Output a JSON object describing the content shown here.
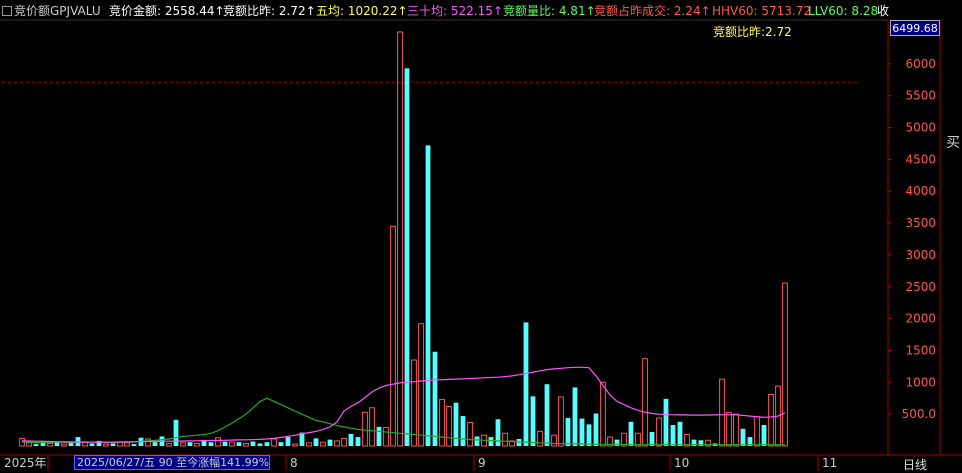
{
  "header": {
    "items": [
      {
        "text": "竞价额GPJVALU",
        "color": "#cccccc",
        "x": 14
      },
      {
        "text": "竞价金额: 2558.44↑",
        "color": "#ffffff",
        "x": 109
      },
      {
        "text": "竞额比昨: 2.72↑",
        "color": "#ffffff",
        "x": 223
      },
      {
        "text": "五均: 1020.22↑",
        "color": "#ffff55",
        "x": 316
      },
      {
        "text": "三十均: 522.15↑",
        "color": "#ff55ff",
        "x": 407
      },
      {
        "text": "竞额量比: 4.81↑",
        "color": "#55ff55",
        "x": 503
      },
      {
        "text": "竞额占昨成交: 2.24↑",
        "color": "#ff5555",
        "x": 594
      },
      {
        "text": "HHV60: 5713.72",
        "color": "#ff5555",
        "x": 712
      },
      {
        "text": "LLV60: 8.28",
        "color": "#55ff55",
        "x": 808
      },
      {
        "text": "收",
        "color": "#ffffff",
        "x": 877
      }
    ],
    "sub_label": "竞额比昨:2.72"
  },
  "axis": {
    "current_value": "6499.68",
    "tick_labels": [
      "6500",
      "6000",
      "5500",
      "5000",
      "4500",
      "4000",
      "3500",
      "3000",
      "2500",
      "2000",
      "1500",
      "1000",
      "500.0"
    ],
    "side_button": "买"
  },
  "bottom": {
    "year": "2025年",
    "range_text": "2025/06/27/五 90 至今涨幅141.99%",
    "months": [
      "8",
      "9",
      "10",
      "11"
    ],
    "period": "日线"
  },
  "colors": {
    "up": "#ff5555",
    "down": "#55ffff",
    "ma5": "#ffff55",
    "ma30": "#ff55ff",
    "grid": "#aa0000"
  },
  "chart_data": {
    "type": "bar",
    "ylim": [
      0,
      6500
    ],
    "hhv_line": 5713.72,
    "bars": [
      [
        120,
        1
      ],
      [
        50,
        1
      ],
      [
        30,
        0
      ],
      [
        80,
        0
      ],
      [
        40,
        1
      ],
      [
        60,
        0
      ],
      [
        30,
        1
      ],
      [
        50,
        0
      ],
      [
        140,
        0
      ],
      [
        60,
        1
      ],
      [
        40,
        0
      ],
      [
        80,
        0
      ],
      [
        30,
        1
      ],
      [
        40,
        0
      ],
      [
        60,
        1
      ],
      [
        50,
        1
      ],
      [
        30,
        0
      ],
      [
        130,
        0
      ],
      [
        110,
        1
      ],
      [
        60,
        0
      ],
      [
        150,
        0
      ],
      [
        40,
        1
      ],
      [
        410,
        0
      ],
      [
        50,
        1
      ],
      [
        60,
        0
      ],
      [
        40,
        1
      ],
      [
        90,
        0
      ],
      [
        60,
        0
      ],
      [
        130,
        1
      ],
      [
        70,
        0
      ],
      [
        60,
        1
      ],
      [
        60,
        0
      ],
      [
        40,
        1
      ],
      [
        70,
        0
      ],
      [
        40,
        0
      ],
      [
        60,
        0
      ],
      [
        110,
        1
      ],
      [
        60,
        0
      ],
      [
        140,
        0
      ],
      [
        30,
        1
      ],
      [
        210,
        0
      ],
      [
        50,
        1
      ],
      [
        120,
        0
      ],
      [
        60,
        1
      ],
      [
        100,
        0
      ],
      [
        80,
        1
      ],
      [
        120,
        1
      ],
      [
        190,
        0
      ],
      [
        140,
        0
      ],
      [
        530,
        1
      ],
      [
        600,
        1
      ],
      [
        300,
        0
      ],
      [
        290,
        1
      ],
      [
        3450,
        1
      ],
      [
        6500,
        1
      ],
      [
        5930,
        0
      ],
      [
        1350,
        1
      ],
      [
        1920,
        1
      ],
      [
        4720,
        0
      ],
      [
        1480,
        0
      ],
      [
        730,
        1
      ],
      [
        620,
        1
      ],
      [
        680,
        0
      ],
      [
        470,
        0
      ],
      [
        370,
        1
      ],
      [
        150,
        0
      ],
      [
        170,
        1
      ],
      [
        140,
        0
      ],
      [
        420,
        0
      ],
      [
        200,
        1
      ],
      [
        80,
        1
      ],
      [
        110,
        0
      ],
      [
        1940,
        0
      ],
      [
        780,
        0
      ],
      [
        230,
        1
      ],
      [
        970,
        0
      ],
      [
        170,
        1
      ],
      [
        770,
        1
      ],
      [
        440,
        0
      ],
      [
        920,
        0
      ],
      [
        430,
        0
      ],
      [
        340,
        0
      ],
      [
        510,
        0
      ],
      [
        1000,
        1
      ],
      [
        140,
        1
      ],
      [
        100,
        0
      ],
      [
        200,
        1
      ],
      [
        380,
        0
      ],
      [
        200,
        1
      ],
      [
        1370,
        1
      ],
      [
        220,
        0
      ],
      [
        440,
        1
      ],
      [
        740,
        0
      ],
      [
        330,
        0
      ],
      [
        380,
        0
      ],
      [
        180,
        1
      ],
      [
        100,
        0
      ],
      [
        90,
        0
      ],
      [
        90,
        1
      ],
      [
        40,
        0
      ],
      [
        1050,
        1
      ],
      [
        530,
        1
      ],
      [
        500,
        1
      ],
      [
        270,
        0
      ],
      [
        140,
        0
      ],
      [
        460,
        1
      ],
      [
        330,
        0
      ],
      [
        810,
        1
      ],
      [
        940,
        1
      ],
      [
        2558,
        1
      ]
    ],
    "ma30": [
      80,
      78,
      75,
      73,
      70,
      68,
      65,
      64,
      63,
      62,
      61,
      61,
      60,
      62,
      63,
      64,
      66,
      68,
      70,
      72,
      74,
      75,
      76,
      78,
      80,
      82,
      84,
      86,
      88,
      90,
      92,
      95,
      98,
      100,
      104,
      110,
      120,
      135,
      150,
      170,
      190,
      210,
      230,
      260,
      300,
      380,
      550,
      620,
      680,
      760,
      850,
      910,
      950,
      970,
      990,
      1000,
      1010,
      1020,
      1030,
      1040,
      1040,
      1045,
      1050,
      1055,
      1060,
      1065,
      1070,
      1075,
      1080,
      1090,
      1100,
      1120,
      1140,
      1160,
      1180,
      1200,
      1210,
      1220,
      1230,
      1235,
      1235,
      1230,
      1100,
      950,
      800,
      700,
      650,
      600,
      560,
      530,
      510,
      500,
      495,
      490,
      488,
      486,
      485,
      485,
      486,
      488,
      490,
      492,
      490,
      480,
      470,
      460,
      450,
      455,
      470,
      522
    ],
    "ma5": [
      60,
      58,
      55,
      55,
      58,
      60,
      58,
      55,
      60,
      65,
      60,
      58,
      55,
      55,
      58,
      60,
      62,
      70,
      80,
      90,
      100,
      110,
      130,
      150,
      160,
      170,
      180,
      200,
      240,
      300,
      360,
      430,
      500,
      600,
      700,
      750,
      700,
      650,
      600,
      550,
      500,
      450,
      400,
      380,
      350,
      320,
      300,
      280,
      260,
      250,
      240,
      230,
      220,
      210,
      200,
      190,
      180,
      170,
      160,
      150,
      140,
      130,
      120,
      110,
      100,
      95,
      90,
      85,
      80,
      75,
      70,
      65,
      60,
      55,
      50,
      45,
      40,
      38,
      36,
      34,
      32,
      30,
      28,
      26,
      25,
      24,
      23,
      22,
      21,
      20,
      20,
      20,
      20,
      20,
      20,
      20,
      20,
      20,
      20,
      20,
      20,
      20,
      20,
      20,
      20,
      20,
      20,
      20,
      20,
      20
    ]
  }
}
